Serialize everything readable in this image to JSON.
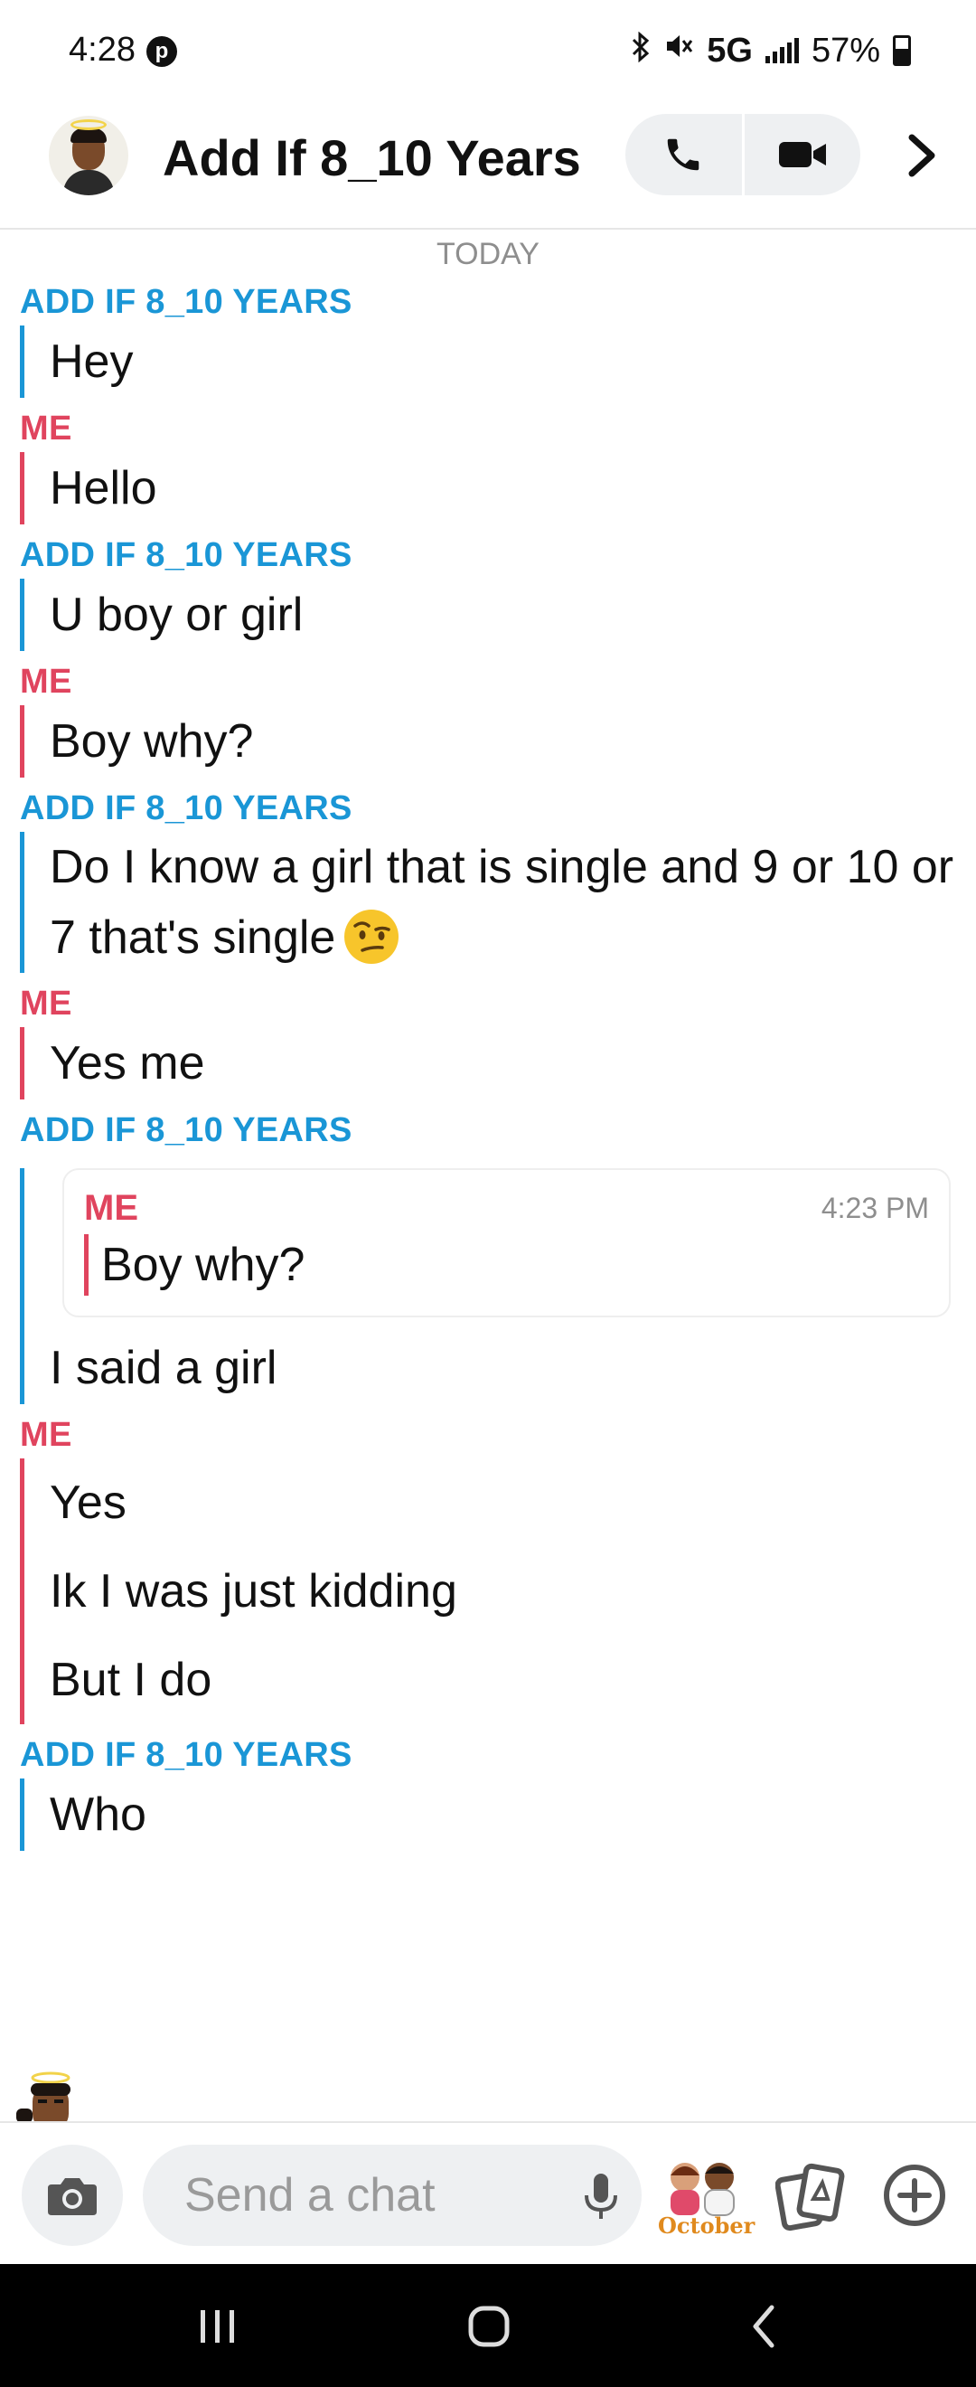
{
  "status_bar": {
    "time": "4:28",
    "network": "5G",
    "battery": "57%"
  },
  "header": {
    "title": "Add If 8_10 Years"
  },
  "date_label": "TODAY",
  "messages": [
    {
      "sender": "ADD IF 8_10 YEARS",
      "lines": [
        "Hey"
      ]
    },
    {
      "sender": "ME",
      "lines": [
        "Hello"
      ]
    },
    {
      "sender": "ADD IF 8_10 YEARS",
      "lines": [
        "U boy or girl"
      ]
    },
    {
      "sender": "ME",
      "lines": [
        "Boy why?"
      ]
    },
    {
      "sender": "ADD IF 8_10 YEARS",
      "lines": [
        "Do I know a girl that is single and 9 or 10 or 7 that's single"
      ],
      "emoji": "raised-eyebrow-emoji"
    },
    {
      "sender": "ME",
      "lines": [
        "Yes me"
      ]
    },
    {
      "sender": "ADD IF 8_10 YEARS",
      "quote": {
        "sender": "ME",
        "time": "4:23 PM",
        "text": "Boy why?"
      },
      "lines": [
        "I said a girl"
      ]
    },
    {
      "sender": "ME",
      "lines": [
        "Yes",
        "Ik I was just kidding",
        "But I do"
      ]
    },
    {
      "sender": "ADD IF 8_10 YEARS",
      "lines": [
        "Who"
      ]
    }
  ],
  "input": {
    "placeholder": "Send a chat",
    "sticker_text": "October"
  },
  "colors": {
    "them": "#1a96d6",
    "me": "#e0445e"
  }
}
